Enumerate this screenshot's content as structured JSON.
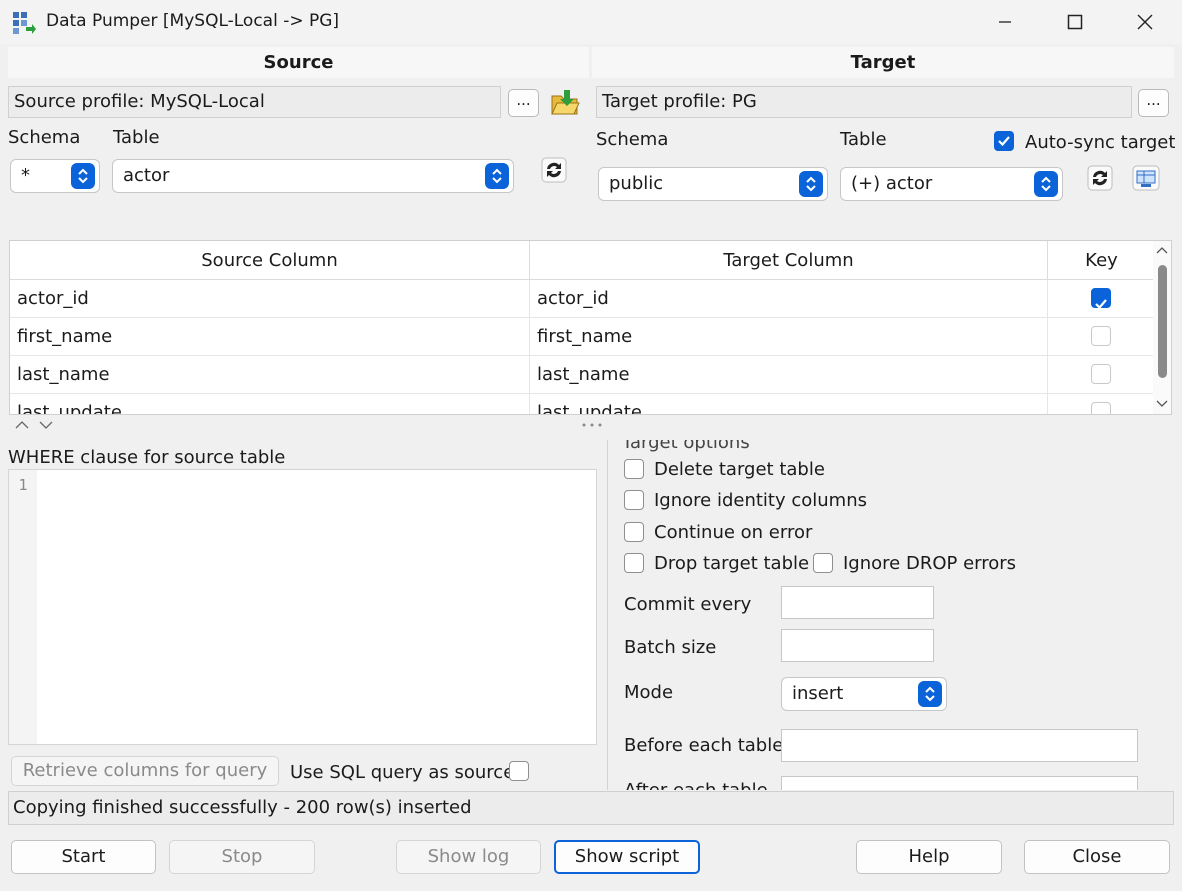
{
  "window": {
    "title": "Data Pumper [MySQL-Local -> PG]",
    "app_icon": "grid-app-icon",
    "controls": [
      "minimize-icon",
      "maximize-icon",
      "close-icon"
    ]
  },
  "source": {
    "header": "Source",
    "profile": "Source profile: MySQL-Local",
    "profile_button": "...",
    "schema_label": "Schema",
    "schema_value": "*",
    "table_label": "Table",
    "table_value": "actor"
  },
  "target": {
    "header": "Target",
    "profile": "Target profile: PG",
    "profile_button": "...",
    "schema_label": "Schema",
    "schema_value": "public",
    "table_label": "Table",
    "table_value": "(+) actor",
    "auto_sync_label": "Auto-sync target",
    "auto_sync_checked": true
  },
  "mapping": {
    "columns": [
      "Source Column",
      "Target Column",
      "Key"
    ],
    "rows": [
      {
        "source": "actor_id",
        "target": "actor_id",
        "key": true
      },
      {
        "source": "first_name",
        "target": "first_name",
        "key": false
      },
      {
        "source": "last_name",
        "target": "last_name",
        "key": false
      },
      {
        "source": "last_update",
        "target": "last_update",
        "key": false
      }
    ]
  },
  "where": {
    "label": "WHERE clause for source table",
    "line_number": "1",
    "retrieve_button": "Retrieve columns for query",
    "use_sql_label": "Use SQL query as source"
  },
  "options": {
    "group_title": "Target options",
    "delete_target": "Delete target table",
    "ignore_identity": "Ignore identity columns",
    "continue_on_error": "Continue on error",
    "drop_target": "Drop target table",
    "ignore_drop_errors": "Ignore DROP errors",
    "commit_every_label": "Commit every",
    "batch_size_label": "Batch size",
    "mode_label": "Mode",
    "mode_value": "insert",
    "before_each_table_label": "Before each table",
    "after_each_table_label": "After each table"
  },
  "status": {
    "message": "Copying finished successfully - 200 row(s) inserted"
  },
  "buttons": {
    "start": "Start",
    "stop": "Stop",
    "show_log": "Show log",
    "show_script": "Show script",
    "help": "Help",
    "close": "Close"
  },
  "colors": {
    "accent": "#0a63d8",
    "background": "#f0f0f0"
  }
}
